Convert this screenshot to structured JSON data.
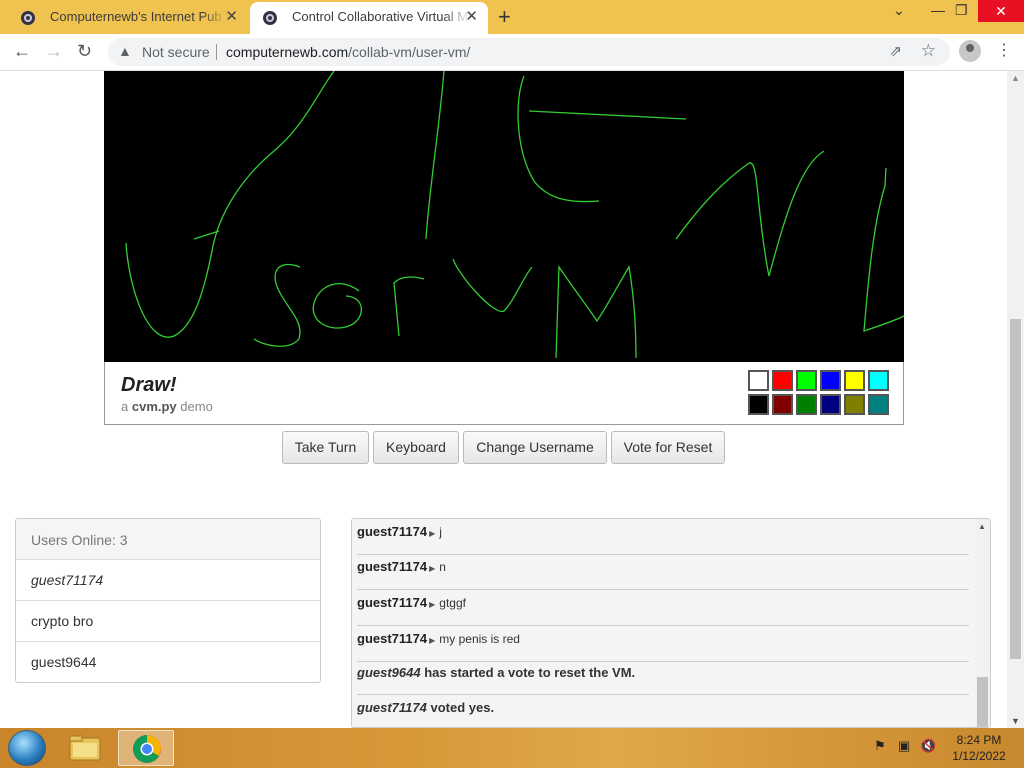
{
  "browser": {
    "tabs": [
      {
        "title": "Computernewb's Internet Pub Hu"
      },
      {
        "title": "Control Collaborative Virtual Ma"
      }
    ],
    "security_label": "Not secure",
    "url_host": "computernewb.com",
    "url_path": "/collab-vm/user-vm/"
  },
  "draw_panel": {
    "title": "Draw!",
    "subtitle_prefix": "a",
    "subtitle_name": "cvm.py",
    "subtitle_suffix": "demo",
    "palette_colors": [
      "#ffffff",
      "#ff0000",
      "#00ff00",
      "#0000ff",
      "#ffff00",
      "#00ffff",
      "#000000",
      "#800000",
      "#008000",
      "#000080",
      "#808000",
      "#008080"
    ]
  },
  "buttons": {
    "take_turn": "Take Turn",
    "keyboard": "Keyboard",
    "change_username": "Change Username",
    "vote_reset": "Vote for Reset"
  },
  "users": {
    "header": "Users Online: 3",
    "list": [
      "guest71174",
      "crypto bro",
      "guest9644"
    ]
  },
  "chat": {
    "messages": [
      {
        "name": "guest71174",
        "text": "j"
      },
      {
        "name": "guest71174",
        "text": "n"
      },
      {
        "name": "guest71174",
        "text": "gtggf"
      },
      {
        "name": "guest71174",
        "text": "my penis is red"
      }
    ],
    "system": [
      {
        "name": "guest9644",
        "text": "has started a vote to reset the VM."
      },
      {
        "name": "guest71174",
        "text": "voted yes."
      }
    ]
  },
  "taskbar": {
    "time": "8:24 PM",
    "date": "1/12/2022"
  }
}
